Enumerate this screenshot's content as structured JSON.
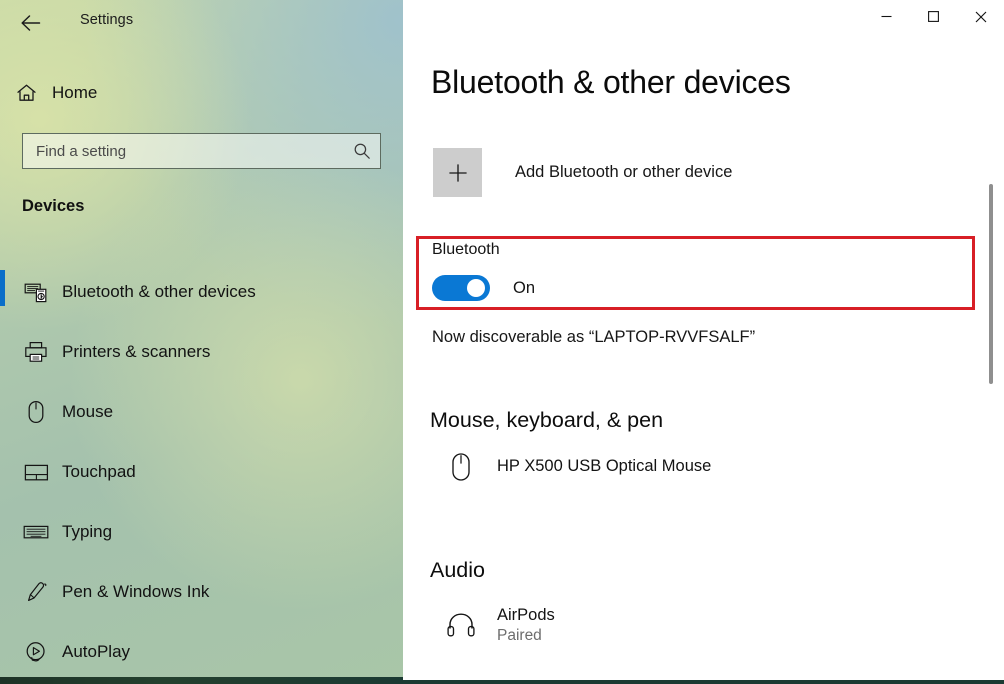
{
  "window": {
    "title": "Settings",
    "back_icon": "back-arrow-icon",
    "controls": {
      "minimize": "–",
      "maximize": "☐",
      "close": "✕"
    }
  },
  "sidebar": {
    "home": {
      "label": "Home",
      "icon": "home-icon"
    },
    "search": {
      "placeholder": "Find a setting",
      "value": "",
      "icon": "search-icon"
    },
    "section_header": "Devices",
    "selection_color": "#0a6ec9",
    "items": [
      {
        "label": "Bluetooth & other devices",
        "icon": "bluetooth-devices-icon",
        "selected": true
      },
      {
        "label": "Printers & scanners",
        "icon": "printer-icon",
        "selected": false
      },
      {
        "label": "Mouse",
        "icon": "mouse-icon",
        "selected": false
      },
      {
        "label": "Touchpad",
        "icon": "touchpad-icon",
        "selected": false
      },
      {
        "label": "Typing",
        "icon": "keyboard-icon",
        "selected": false
      },
      {
        "label": "Pen & Windows Ink",
        "icon": "pen-icon",
        "selected": false
      },
      {
        "label": "AutoPlay",
        "icon": "autoplay-icon",
        "selected": false
      }
    ]
  },
  "main": {
    "page_title": "Bluetooth & other devices",
    "add_device": {
      "label": "Add Bluetooth or other device",
      "icon": "plus-icon"
    },
    "bluetooth": {
      "label": "Bluetooth",
      "state": "On",
      "toggle_on": true,
      "accent_color": "#0a78d4",
      "highlight_color": "#d81f26",
      "discoverable_text": "Now discoverable as “LAPTOP-RVVFSALF”"
    },
    "groups": [
      {
        "heading": "Mouse, keyboard, & pen",
        "devices": [
          {
            "name": "HP X500 USB Optical Mouse",
            "status": "",
            "icon": "mouse-icon"
          }
        ]
      },
      {
        "heading": "Audio",
        "devices": [
          {
            "name": "AirPods",
            "status": "Paired",
            "icon": "headphones-icon"
          }
        ]
      }
    ]
  }
}
